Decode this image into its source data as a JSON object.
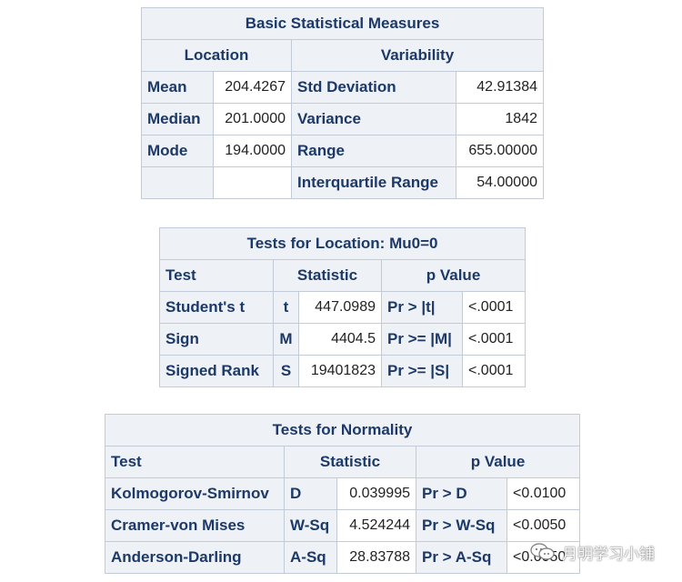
{
  "basic": {
    "title": "Basic Statistical Measures",
    "location_header": "Location",
    "variability_header": "Variability",
    "rows": [
      {
        "loc_label": "Mean",
        "loc_value": "204.4267",
        "var_label": "Std Deviation",
        "var_value": "42.91384"
      },
      {
        "loc_label": "Median",
        "loc_value": "201.0000",
        "var_label": "Variance",
        "var_value": "1842"
      },
      {
        "loc_label": "Mode",
        "loc_value": "194.0000",
        "var_label": "Range",
        "var_value": "655.00000"
      },
      {
        "loc_label": "",
        "loc_value": "",
        "var_label": "Interquartile Range",
        "var_value": "54.00000"
      }
    ]
  },
  "location_tests": {
    "title": "Tests for Location: Mu0=0",
    "headers": {
      "test": "Test",
      "statistic": "Statistic",
      "pvalue": "p Value"
    },
    "rows": [
      {
        "test": "Student's t",
        "sym": "t",
        "stat": "447.0989",
        "pr": "Pr > |t|",
        "p": "<.0001"
      },
      {
        "test": "Sign",
        "sym": "M",
        "stat": "4404.5",
        "pr": "Pr >= |M|",
        "p": "<.0001"
      },
      {
        "test": "Signed Rank",
        "sym": "S",
        "stat": "19401823",
        "pr": "Pr >= |S|",
        "p": "<.0001"
      }
    ]
  },
  "normality_tests": {
    "title": "Tests for Normality",
    "headers": {
      "test": "Test",
      "statistic": "Statistic",
      "pvalue": "p Value"
    },
    "rows": [
      {
        "test": "Kolmogorov-Smirnov",
        "sym": "D",
        "stat": "0.039995",
        "pr": "Pr > D",
        "p": "<0.0100"
      },
      {
        "test": "Cramer-von Mises",
        "sym": "W-Sq",
        "stat": "4.524244",
        "pr": "Pr > W-Sq",
        "p": "<0.0050"
      },
      {
        "test": "Anderson-Darling",
        "sym": "A-Sq",
        "stat": "28.83788",
        "pr": "Pr > A-Sq",
        "p": "<0.0050"
      }
    ]
  },
  "watermark": {
    "text": "月明学习小铺",
    "icon": "wechat-icon"
  }
}
